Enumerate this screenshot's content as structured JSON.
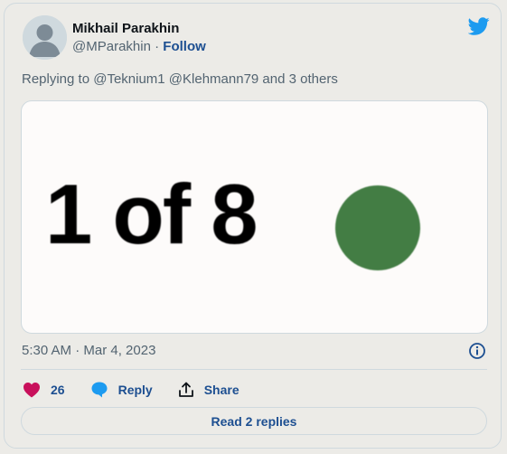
{
  "author": {
    "name": "Mikhail Parakhin",
    "handle": "@MParakhin",
    "separator": "·",
    "follow_label": "Follow"
  },
  "reply_context": "Replying to @Teknium1 @Klehmann79 and 3 others",
  "media": {
    "text": "1 of 8",
    "dot_color": "#437d44"
  },
  "timestamp": "5:30 AM · Mar 4, 2023",
  "actions": {
    "like_count": "26",
    "reply_label": "Reply",
    "share_label": "Share"
  },
  "read_replies_label": "Read 2 replies",
  "icons": {
    "platform": "twitter-bird-icon",
    "info": "info-icon",
    "like": "heart-icon",
    "reply": "speech-bubble-icon",
    "share": "share-arrow-icon"
  },
  "colors": {
    "brand": "#1d9bf0",
    "link": "#1d4f91",
    "like": "#c8105b"
  }
}
